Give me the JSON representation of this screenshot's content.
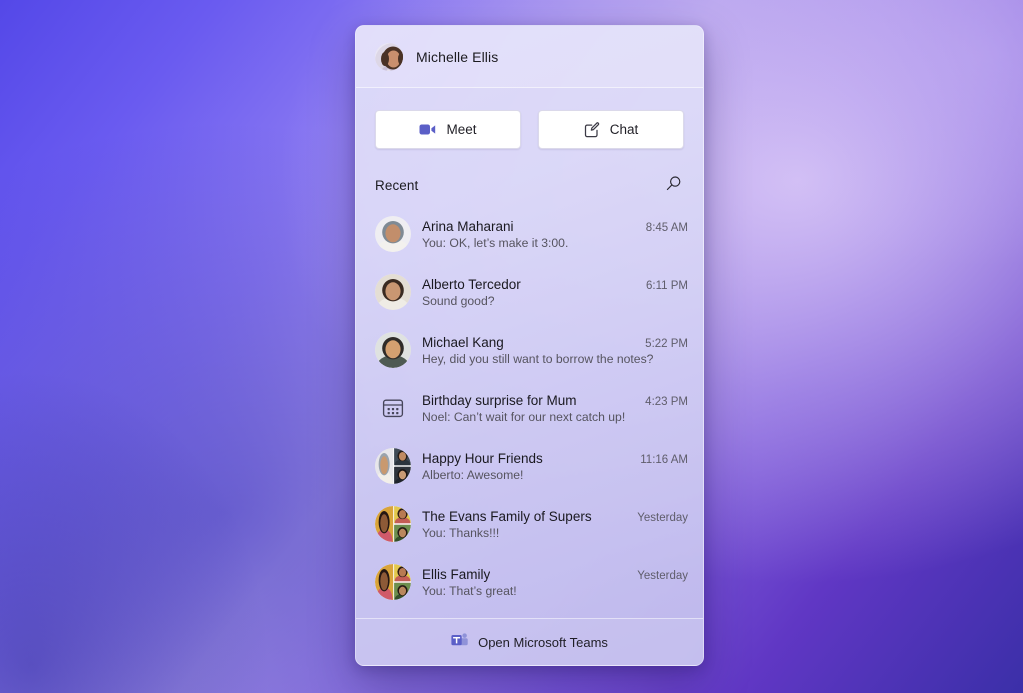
{
  "window": {
    "title": "Microsoft Teams chat flyout"
  },
  "header": {
    "user_name": "Michelle Ellis",
    "avatar_icon": "user-avatar-photo"
  },
  "actions": [
    {
      "label": "Meet",
      "icon": "video-camera-icon"
    },
    {
      "label": "Chat",
      "icon": "compose-chat-icon"
    }
  ],
  "recent": {
    "label": "Recent",
    "search_icon": "search-icon"
  },
  "chats": [
    {
      "title": "Arina Maharani",
      "preview": "You: OK, let’s make it 3:00.",
      "time": "8:45 AM",
      "avatar_type": "photo-single",
      "avatar_icon": "contact-avatar-photo"
    },
    {
      "title": "Alberto Tercedor",
      "preview": "Sound good?",
      "time": "6:11 PM",
      "avatar_type": "photo-single",
      "avatar_icon": "contact-avatar-photo"
    },
    {
      "title": "Michael Kang",
      "preview": "Hey, did you still want to borrow the notes?",
      "time": "5:22 PM",
      "avatar_type": "photo-single",
      "avatar_icon": "contact-avatar-photo"
    },
    {
      "title": "Birthday surprise for Mum",
      "preview": "Noel: Can’t wait for our next catch up!",
      "time": "4:23 PM",
      "avatar_type": "calendar",
      "avatar_icon": "calendar-icon"
    },
    {
      "title": "Happy Hour Friends",
      "preview": "Alberto: Awesome!",
      "time": "11:16 AM",
      "avatar_type": "photo-group",
      "avatar_icon": "group-avatar-photo"
    },
    {
      "title": "The Evans Family of Supers",
      "preview": "You: Thanks!!!",
      "time": "Yesterday",
      "avatar_type": "photo-group",
      "avatar_icon": "group-avatar-photo"
    },
    {
      "title": "Ellis Family",
      "preview": "You: That’s great!",
      "time": "Yesterday",
      "avatar_type": "photo-group",
      "avatar_icon": "group-avatar-photo"
    }
  ],
  "footer": {
    "open_label": "Open Microsoft Teams",
    "icon": "microsoft-teams-logo-icon"
  },
  "colors": {
    "teams_purple": "#5b5fc7",
    "panel_bg": "#dedcf8",
    "button_bg": "#ffffff",
    "text_primary": "#1a1920",
    "text_secondary": "#56545f",
    "wallpaper_from": "#5448e8",
    "wallpaper_to": "#3b2fa8"
  }
}
